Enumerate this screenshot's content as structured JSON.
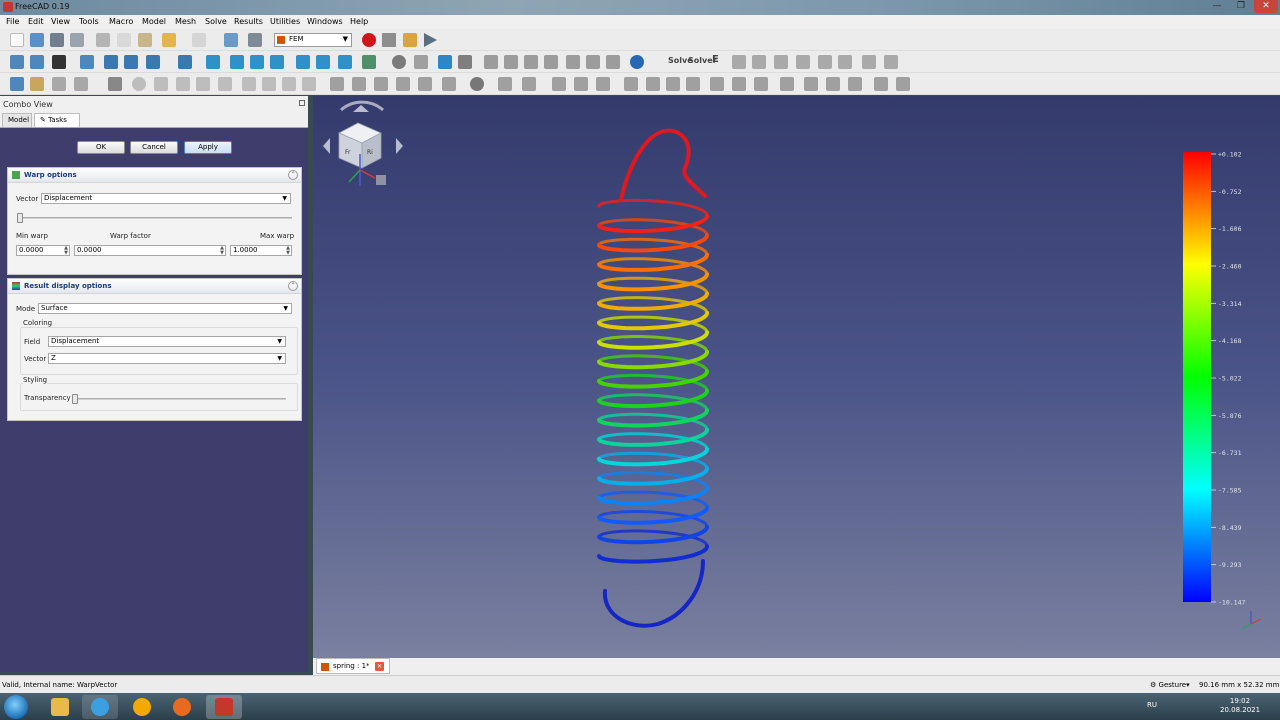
{
  "window": {
    "title": "FreeCAD 0.19",
    "min": "—",
    "max": "❐",
    "close": "✕"
  },
  "menus": [
    "File",
    "Edit",
    "View",
    "Tools",
    "Macro",
    "Model",
    "Mesh",
    "Solve",
    "Results",
    "Utilities",
    "Windows",
    "Help"
  ],
  "toolbar": {
    "workbench": "FEM",
    "solver_text": "Solve",
    "solver_text2": "Solver",
    "e_text": "E"
  },
  "combo": {
    "title": "Combo View",
    "tabs": {
      "model": "Model",
      "tasks": "Tasks"
    },
    "buttons": {
      "ok": "OK",
      "cancel": "Cancel",
      "apply": "Apply"
    },
    "warp": {
      "title": "Warp options",
      "vector_label": "Vector",
      "vector_value": "Displacement",
      "warp_slider_fraction": 0,
      "min_label": "Min warp",
      "factor_label": "Warp factor",
      "max_label": "Max warp",
      "min_value": "0.0000",
      "factor_value": "0.0000",
      "max_value": "1.0000"
    },
    "result": {
      "title": "Result display options",
      "mode_label": "Mode",
      "mode_value": "Surface",
      "coloring_label": "Coloring",
      "field_label": "Field",
      "field_value": "Displacement",
      "vector_label": "Vector",
      "vector_value": "Z",
      "styling_label": "Styling",
      "transparency_label": "Transparency",
      "transparency_fraction": 0
    }
  },
  "viewport": {
    "colorbar_labels": [
      "+0.102",
      "-0.752",
      "-1.606",
      "-2.460",
      "-3.314",
      "-4.168",
      "-5.022",
      "-5.876",
      "-6.731",
      "-7.585",
      "-8.439",
      "-9.293",
      "-10.147"
    ],
    "cube_front": "Fr",
    "cube_right": "Ri",
    "colors": {
      "top": "#ff0000",
      "mid": "#00ff00",
      "bottom": "#0000ff"
    }
  },
  "document": {
    "tab_label": "spring : 1*",
    "close": "✕"
  },
  "status": {
    "message": "Valid, Internal name: WarpVector",
    "nav_style": "Gesture",
    "dimensions": "90.16 mm x 52.32 mm"
  },
  "taskbar": {
    "lang": "RU",
    "time": "19:02",
    "date": "20.08.2021"
  }
}
